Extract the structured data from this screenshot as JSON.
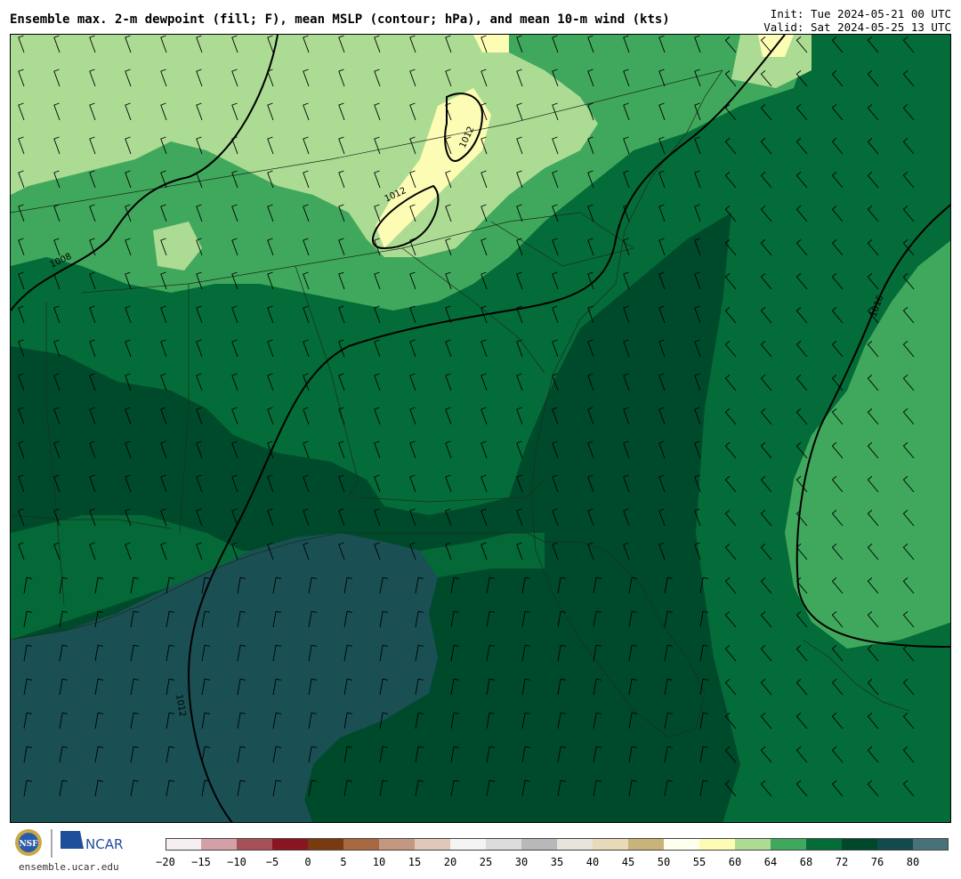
{
  "header": {
    "title": "Ensemble max. 2-m dewpoint (fill; F), mean MSLP (contour; hPa), and mean 10-m wind (kts)",
    "init": "Init: Tue 2024-05-21 00 UTC",
    "valid": "Valid: Sat 2024-05-25 13 UTC"
  },
  "map": {
    "field": "2-m dewpoint",
    "contour_labels": [
      "1008",
      "1012",
      "1012",
      "1012",
      "1012",
      "1016"
    ]
  },
  "footer": {
    "org": "NCAR",
    "nsf": "NSF",
    "site": "ensemble.ucar.edu"
  },
  "colorbar": {
    "labels": [
      "−20",
      "−15",
      "−10",
      "−5",
      "0",
      "5",
      "10",
      "15",
      "20",
      "25",
      "30",
      "35",
      "40",
      "45",
      "50",
      "55",
      "60",
      "64",
      "68",
      "72",
      "76",
      "80"
    ],
    "colors": [
      "#f5eef0",
      "#d4a0a8",
      "#a85058",
      "#8a1420",
      "#7a3a10",
      "#a86840",
      "#c49880",
      "#e0c8b8",
      "#f4f4f4",
      "#dcdcdc",
      "#b8b8b8",
      "#e8e4dc",
      "#e8dab8",
      "#c8b478",
      "#fffff0",
      "#fcfcb4",
      "#acdc94",
      "#40a85c",
      "#046c38",
      "#00482c",
      "#124a50",
      "#48727a"
    ]
  }
}
